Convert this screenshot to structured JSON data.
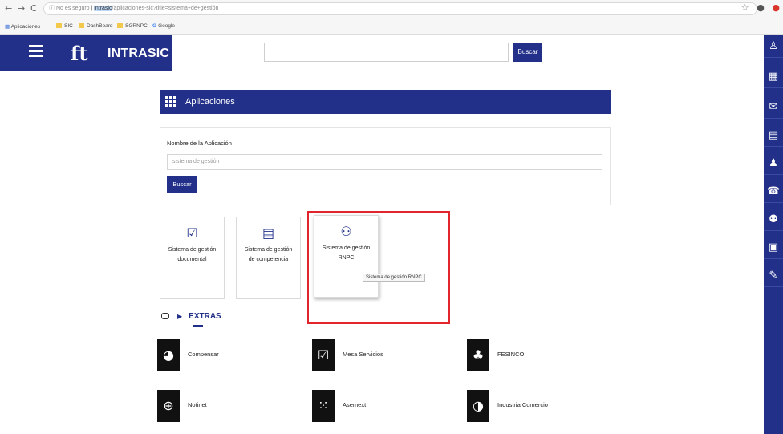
{
  "browser": {
    "back": "←",
    "forward": "→",
    "reload": "C",
    "security": "ⓘ No es seguro",
    "host": "intrasic",
    "path": "/aplicaciones-sic?title=sistema+de+gestión",
    "star": "☆",
    "profile": "●",
    "ext": "●",
    "bookmarks": [
      {
        "label": "Aplicaciones",
        "type": "apps"
      },
      {
        "label": "SIC",
        "type": "folder"
      },
      {
        "label": "DashBoard",
        "type": "folder"
      },
      {
        "label": "SGRNPC",
        "type": "folder"
      },
      {
        "label": "Google",
        "type": "google"
      }
    ]
  },
  "header": {
    "logo_mark": "ft",
    "brand_prefix": "INTRA",
    "brand_suffix": "SIC",
    "search_value": "",
    "search_button": "Buscar"
  },
  "rail": {
    "icons": [
      "user-key-icon",
      "apps-grid-icon",
      "mail-icon",
      "calendar-icon",
      "person-icon",
      "contact-icon",
      "group-icon",
      "clipboard-icon",
      "wrench-icon"
    ],
    "glyphs": [
      "♙",
      "▦",
      "✉",
      "▤",
      "♟",
      "☎",
      "⚉",
      "▣",
      "✎"
    ]
  },
  "apps": {
    "title": "Aplicaciones",
    "filter_label": "Nombre de la Aplicación",
    "filter_value": "sistema de gestión",
    "search_button": "Buscar",
    "tiles": [
      {
        "label_line1": "Sistema de gestión",
        "label_line2": "documental",
        "icon": "document-check-icon",
        "glyph": "☑"
      },
      {
        "label_line1": "Sistema de gestión",
        "label_line2": "de competencia",
        "icon": "clipboard-chart-icon",
        "glyph": "▤"
      },
      {
        "label_line1": "Sistema de gestión",
        "label_line2": "RNPC",
        "icon": "people-shield-icon",
        "glyph": "⚇"
      }
    ],
    "tooltip": "Sistema de gestión RNPC"
  },
  "extras": {
    "title": "EXTRAS",
    "items": [
      {
        "label": "Compensar",
        "icon": "compensar-icon",
        "glyph": "◕"
      },
      {
        "label": "Mesa Servicios",
        "icon": "mesa-servicios-icon",
        "glyph": "☑"
      },
      {
        "label": "FESINCO",
        "icon": "fesinco-icon",
        "glyph": "♣"
      },
      {
        "label": "Notinet",
        "icon": "globe-icon",
        "glyph": "⊕"
      },
      {
        "label": "Asemext",
        "icon": "asemext-icon",
        "glyph": "⁙"
      },
      {
        "label": "Industria Comercio",
        "icon": "industria-comercio-icon",
        "glyph": "◑"
      }
    ]
  },
  "colors": {
    "primary": "#22308a",
    "highlight": "#e0262c"
  }
}
